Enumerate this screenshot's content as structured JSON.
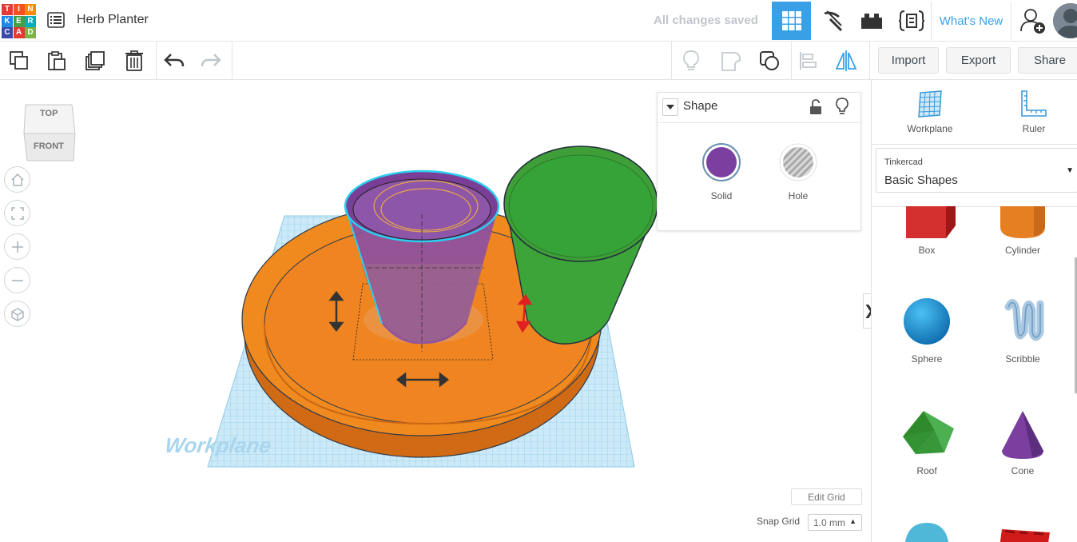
{
  "app": {
    "logo_letters": [
      "T",
      "I",
      "N",
      "K",
      "E",
      "R",
      "C",
      "A",
      "D"
    ],
    "logo_colors": [
      "#e53935",
      "#f4511e",
      "#fb8c00",
      "#1e88e5",
      "#43a047",
      "#00acc1",
      "#3949ab",
      "#e53935",
      "#7cb342"
    ],
    "project_title": "Herb Planter",
    "save_status": "All changes saved",
    "whats_new": "What's New",
    "accent_color": "#3aa0e6"
  },
  "header_icons": [
    "grid-view-icon",
    "pickaxe-icon",
    "bricks-icon",
    "codeblocks-icon"
  ],
  "toolbar": {
    "import": "Import",
    "export": "Export",
    "share": "Share"
  },
  "view_cube": {
    "top": "TOP",
    "front": "FRONT"
  },
  "workplane_label": "Workplane",
  "shape_panel": {
    "title": "Shape",
    "solid": "Solid",
    "hole": "Hole",
    "solid_color": "#7b3fa0"
  },
  "grid_controls": {
    "edit_grid": "Edit Grid",
    "snap_grid_label": "Snap Grid",
    "snap_grid_value": "1.0 mm"
  },
  "sidebar": {
    "tools": [
      {
        "label": "Workplane",
        "icon": "workplane-icon"
      },
      {
        "label": "Ruler",
        "icon": "ruler-icon"
      }
    ],
    "library": {
      "provider": "Tinkercad",
      "name": "Basic Shapes"
    },
    "shapes": [
      {
        "label": "Box",
        "color": "#d32f2f"
      },
      {
        "label": "Cylinder",
        "color": "#e67e22"
      },
      {
        "label": "Sphere",
        "color": "#1e90d6"
      },
      {
        "label": "Scribble",
        "color": "#8fb7d9"
      },
      {
        "label": "Roof",
        "color": "#3a9b36"
      },
      {
        "label": "Cone",
        "color": "#7b3fa0"
      }
    ]
  }
}
